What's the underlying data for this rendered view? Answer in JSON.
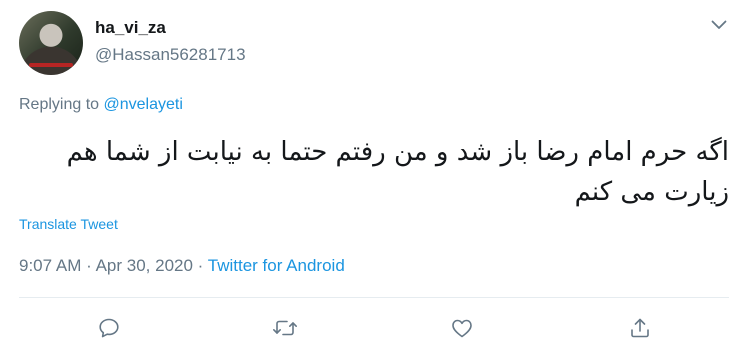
{
  "user": {
    "display_name": "ha_vi_za",
    "handle": "@Hassan56281713"
  },
  "reply": {
    "prefix": "Replying to",
    "mention": "@nvelayeti"
  },
  "tweet": {
    "text": "اگه حرم امام رضا باز شد و من رفتم حتما به نیابت از شما هم زیارت می کنم",
    "translate_label": "Translate Tweet",
    "time": "9:07 AM",
    "date": "Apr 30, 2020",
    "separator": "·",
    "source": "Twitter for Android"
  },
  "icons": {
    "menu": "chevron-down-icon",
    "reply": "reply-icon",
    "retweet": "retweet-icon",
    "like": "like-icon",
    "share": "share-icon"
  },
  "colors": {
    "link": "#1b95e0",
    "muted": "#657786",
    "text": "#14171a"
  }
}
